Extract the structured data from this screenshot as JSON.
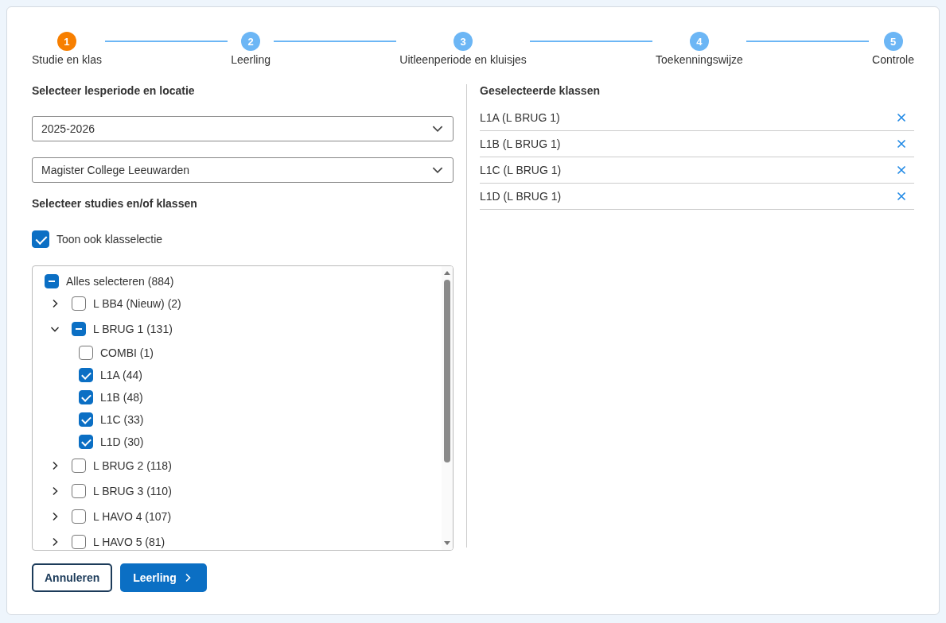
{
  "steps": [
    {
      "number": "1",
      "label": "Studie en klas",
      "selected": true
    },
    {
      "number": "2",
      "label": "Leerling",
      "selected": false
    },
    {
      "number": "3",
      "label": "Uitleenperiode en kluisjes",
      "selected": false
    },
    {
      "number": "4",
      "label": "Toekenningswijze",
      "selected": false
    },
    {
      "number": "5",
      "label": "Controle",
      "selected": false
    }
  ],
  "left": {
    "period_heading": "Selecteer lesperiode en locatie",
    "selects": [
      {
        "value": "2025-2026"
      },
      {
        "value": "Magister College Leeuwarden"
      }
    ],
    "studies_heading": "Selecteer studies en/of klassen",
    "class_toggle": {
      "label": "Toon ook klasselectie",
      "checked": true
    },
    "tree": {
      "root": {
        "label": "Alles selecteren (884)",
        "checked": false,
        "indeterminate": true
      },
      "items": [
        {
          "label": "L BB4 (Nieuw) (2)",
          "checked": false,
          "indeterminate": false,
          "expanded": false
        },
        {
          "label": "L BRUG 1 (131)",
          "checked": false,
          "indeterminate": true,
          "expanded": true,
          "children": [
            {
              "label": "COMBI (1)",
              "checked": false
            },
            {
              "label": "L1A (44)",
              "checked": true
            },
            {
              "label": "L1B (48)",
              "checked": true
            },
            {
              "label": "L1C (33)",
              "checked": true
            },
            {
              "label": "L1D (30)",
              "checked": true
            }
          ]
        },
        {
          "label": "L BRUG 2 (118)",
          "checked": false,
          "indeterminate": false,
          "expanded": false
        },
        {
          "label": "L BRUG 3 (110)",
          "checked": false,
          "indeterminate": false,
          "expanded": false
        },
        {
          "label": "L HAVO 4 (107)",
          "checked": false,
          "indeterminate": false,
          "expanded": false
        },
        {
          "label": "L HAVO 5 (81)",
          "checked": false,
          "indeterminate": false,
          "expanded": false
        }
      ]
    }
  },
  "right": {
    "heading": "Geselecteerde klassen",
    "selected_classes": [
      {
        "label": "L1A (L BRUG 1)"
      },
      {
        "label": "L1B (L BRUG 1)"
      },
      {
        "label": "L1C (L BRUG 1)"
      },
      {
        "label": "L1D (L BRUG 1)"
      }
    ]
  },
  "buttons": [
    {
      "kind": "secondary",
      "label": "Annuleren"
    },
    {
      "kind": "primary",
      "label": "Leerling"
    }
  ]
}
